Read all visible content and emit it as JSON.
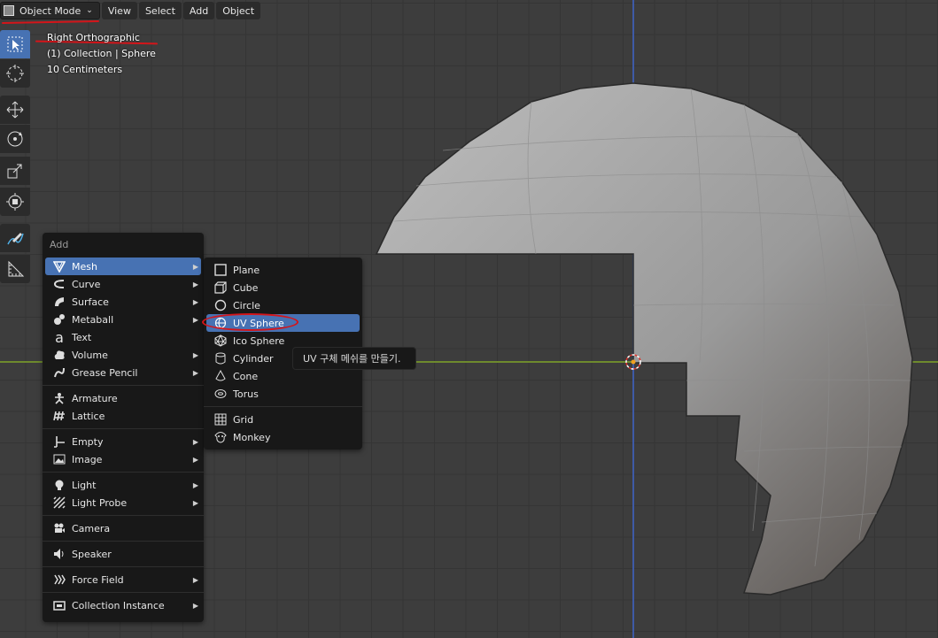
{
  "header": {
    "mode_label": "Object Mode",
    "menus": [
      "View",
      "Select",
      "Add",
      "Object"
    ]
  },
  "viewport_info": {
    "view_name": "Right Orthographic",
    "collection_line": "(1) Collection | Sphere",
    "scale_line": "10 Centimeters"
  },
  "toolbar": {
    "tools": [
      "select-box",
      "cursor",
      "move",
      "rotate",
      "scale",
      "transform",
      "annotate",
      "measure"
    ],
    "active": "select-box"
  },
  "add_menu": {
    "title": "Add",
    "items": [
      {
        "label": "Mesh",
        "icon": "mesh-icon",
        "submenu": true
      },
      {
        "label": "Curve",
        "icon": "curve-icon",
        "submenu": true
      },
      {
        "label": "Surface",
        "icon": "surface-icon",
        "submenu": true
      },
      {
        "label": "Metaball",
        "icon": "metaball-icon",
        "submenu": true
      },
      {
        "label": "Text",
        "icon": "text-icon",
        "submenu": false
      },
      {
        "label": "Volume",
        "icon": "volume-icon",
        "submenu": true
      },
      {
        "label": "Grease Pencil",
        "icon": "grease-pencil-icon",
        "submenu": true
      },
      {
        "label": "Armature",
        "icon": "armature-icon",
        "submenu": false
      },
      {
        "label": "Lattice",
        "icon": "lattice-icon",
        "submenu": false
      },
      {
        "label": "Empty",
        "icon": "empty-icon",
        "submenu": true
      },
      {
        "label": "Image",
        "icon": "image-icon",
        "submenu": true
      },
      {
        "label": "Light",
        "icon": "light-icon",
        "submenu": true
      },
      {
        "label": "Light Probe",
        "icon": "light-probe-icon",
        "submenu": true
      },
      {
        "label": "Camera",
        "icon": "camera-icon",
        "submenu": false
      },
      {
        "label": "Speaker",
        "icon": "speaker-icon",
        "submenu": false
      },
      {
        "label": "Force Field",
        "icon": "force-field-icon",
        "submenu": true
      },
      {
        "label": "Collection Instance",
        "icon": "collection-instance-icon",
        "submenu": true
      }
    ]
  },
  "mesh_menu": {
    "items": [
      {
        "label": "Plane",
        "icon": "plane-icon"
      },
      {
        "label": "Cube",
        "icon": "cube-icon"
      },
      {
        "label": "Circle",
        "icon": "circle-icon"
      },
      {
        "label": "UV Sphere",
        "icon": "uv-sphere-icon"
      },
      {
        "label": "Ico Sphere",
        "icon": "ico-sphere-icon"
      },
      {
        "label": "Cylinder",
        "icon": "cylinder-icon"
      },
      {
        "label": "Cone",
        "icon": "cone-icon"
      },
      {
        "label": "Torus",
        "icon": "torus-icon"
      },
      {
        "label": "Grid",
        "icon": "grid-icon"
      },
      {
        "label": "Monkey",
        "icon": "monkey-icon"
      }
    ],
    "highlighted": "UV Sphere"
  },
  "tooltip": {
    "text": "UV 구체 메쉬를 만들기."
  },
  "colors": {
    "highlight": "#4772b3",
    "annotation_red": "#d4151a",
    "x_axis": "#6e8a2d",
    "z_axis": "#3e5aa6"
  }
}
